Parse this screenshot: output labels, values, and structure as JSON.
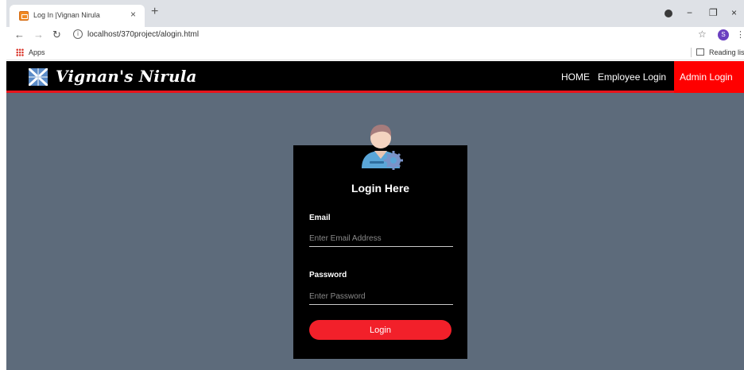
{
  "browser": {
    "tab_title": "Log In |Vignan Nirula",
    "tab_close": "×",
    "new_tab": "+",
    "url": "localhost/370project/alogin.html",
    "avatar_letter": "S",
    "bookmarks": {
      "apps_label": "Apps",
      "reading_list_label": "Reading list"
    },
    "window_controls": {
      "minimize": "−",
      "restore": "❐",
      "close": "×"
    },
    "icons": [
      "back-icon",
      "forward-icon",
      "reload-icon",
      "info-icon",
      "star-icon",
      "menu-icon",
      "apps-icon",
      "reading-list-icon"
    ]
  },
  "site": {
    "brand": "Vignan's Nirula",
    "nav": {
      "home": "HOME",
      "employee_login": "Employee Login",
      "admin_login": "Admin Login"
    },
    "colors": {
      "nav_bg": "#000000",
      "accent": "#ff0000",
      "page_bg": "#5d6b7b",
      "button": "#f2202a"
    }
  },
  "login": {
    "title": "Login Here",
    "email_label": "Email",
    "email_placeholder": "Enter Email Address",
    "email_value": "",
    "password_label": "Password",
    "password_placeholder": "Enter Password",
    "password_value": "",
    "button_label": "Login"
  }
}
